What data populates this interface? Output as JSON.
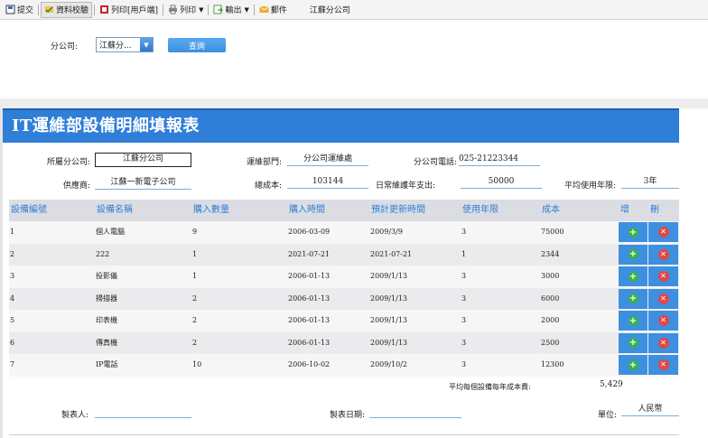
{
  "toolbar": {
    "submit": "提交",
    "validate": "資料校驗",
    "print_client": "列印[用戶端]",
    "print": "列印",
    "export": "輸出",
    "mail": "郵件",
    "title": "江蘇分公司"
  },
  "filter": {
    "label": "分公司:",
    "value": "江蘇分...",
    "query_button": "查詢"
  },
  "report": {
    "title": "IT運維部設備明細填報表",
    "branch_label": "所屬分公司:",
    "branch_value": "江蘇分公司",
    "dept_label": "運維部門:",
    "dept_value": "分公司運維處",
    "phone_label": "分公司電話:",
    "phone_value": "025-21223344",
    "supplier_label": "供應商:",
    "supplier_value": "江蘇一新電子公司",
    "total_cost_label": "總成本:",
    "total_cost_value": "103144",
    "maintenance_label": "日常維護年支出:",
    "maintenance_value": "50000",
    "avg_life_label": "平均使用年限:",
    "avg_life_value": "3年",
    "avg_cost_label": "平均每個設備每年成本費:",
    "avg_cost_value": "5,429",
    "maker_label": "製表人:",
    "maker_value": "",
    "date_label": "製表日期:",
    "date_value": "",
    "unit_label": "單位:",
    "unit_value": "人民幣"
  },
  "table": {
    "headers": [
      "設備編號",
      "設備名稱",
      "購入數量",
      "購入時間",
      "預計更新時間",
      "使用年限",
      "成本",
      "增",
      "刪"
    ],
    "rows": [
      [
        "1",
        "個人電腦",
        "9",
        "2006-03-09",
        "2009/3/9",
        "3",
        "75000"
      ],
      [
        "2",
        "222",
        "1",
        "2021-07-21",
        "2021-07-21",
        "1",
        "2344"
      ],
      [
        "3",
        "投影儀",
        "1",
        "2006-01-13",
        "2009/1/13",
        "3",
        "3000"
      ],
      [
        "4",
        "掃描器",
        "2",
        "2006-01-13",
        "2009/1/13",
        "3",
        "6000"
      ],
      [
        "5",
        "印表機",
        "2",
        "2006-01-13",
        "2009/1/13",
        "3",
        "2000"
      ],
      [
        "6",
        "傳真機",
        "2",
        "2006-01-13",
        "2009/1/13",
        "3",
        "2500"
      ],
      [
        "7",
        "IP電話",
        "10",
        "2006-10-02",
        "2009/10/2",
        "3",
        "12300"
      ]
    ]
  },
  "colors": {
    "accent": "#2f7ed8",
    "header_bg": "#dcdde2",
    "add": "#36b24a",
    "delete": "#e04848"
  }
}
